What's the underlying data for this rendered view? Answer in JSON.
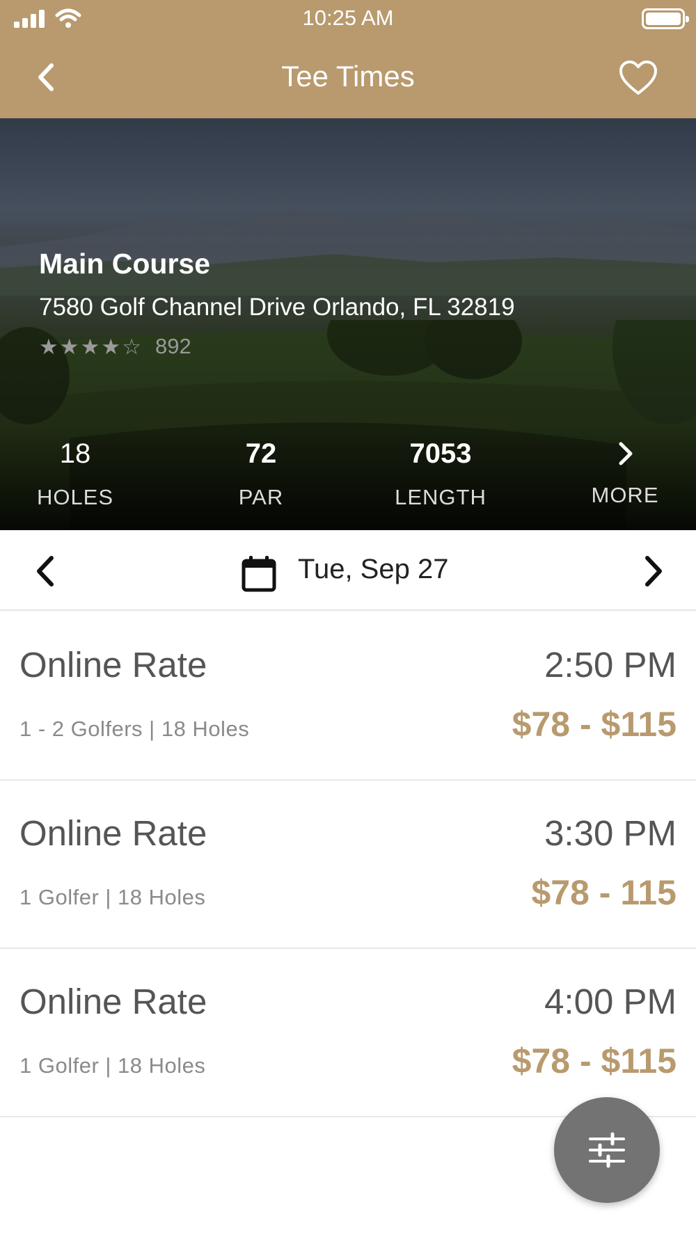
{
  "status": {
    "time": "10:25 AM"
  },
  "nav": {
    "title": "Tee Times"
  },
  "course": {
    "name": "Main Course",
    "address": "7580 Golf Channel Drive Orlando, FL 32819",
    "rating_stars": 4,
    "rating_max": 5,
    "review_count": "892"
  },
  "stats": [
    {
      "value": "18",
      "label": "HOLES"
    },
    {
      "value": "72",
      "label": "PAR"
    },
    {
      "value": "7053",
      "label": "LENGTH"
    },
    {
      "value": "",
      "label": "MORE"
    }
  ],
  "date": {
    "label": "Tue, Sep 27"
  },
  "rates": [
    {
      "name": "Online Rate",
      "time": "2:50 PM",
      "details": "1 - 2 Golfers | 18 Holes",
      "price": "$78 - $115"
    },
    {
      "name": "Online Rate",
      "time": "3:30 PM",
      "details": "1 Golfer | 18 Holes",
      "price": "$78 - 115"
    },
    {
      "name": "Online Rate",
      "time": "4:00 PM",
      "details": "1 Golfer | 18 Holes",
      "price": "$78 - $115"
    }
  ],
  "colors": {
    "brand": "#b89a6e",
    "fab": "#737373"
  },
  "icons": {
    "status": [
      "signal-icon",
      "wifi-icon",
      "battery-icon"
    ],
    "nav": [
      "back-icon",
      "heart-icon"
    ],
    "date": [
      "chevron-left-icon",
      "calendar-icon",
      "chevron-right-icon"
    ],
    "fab": "filter-sliders-icon"
  }
}
